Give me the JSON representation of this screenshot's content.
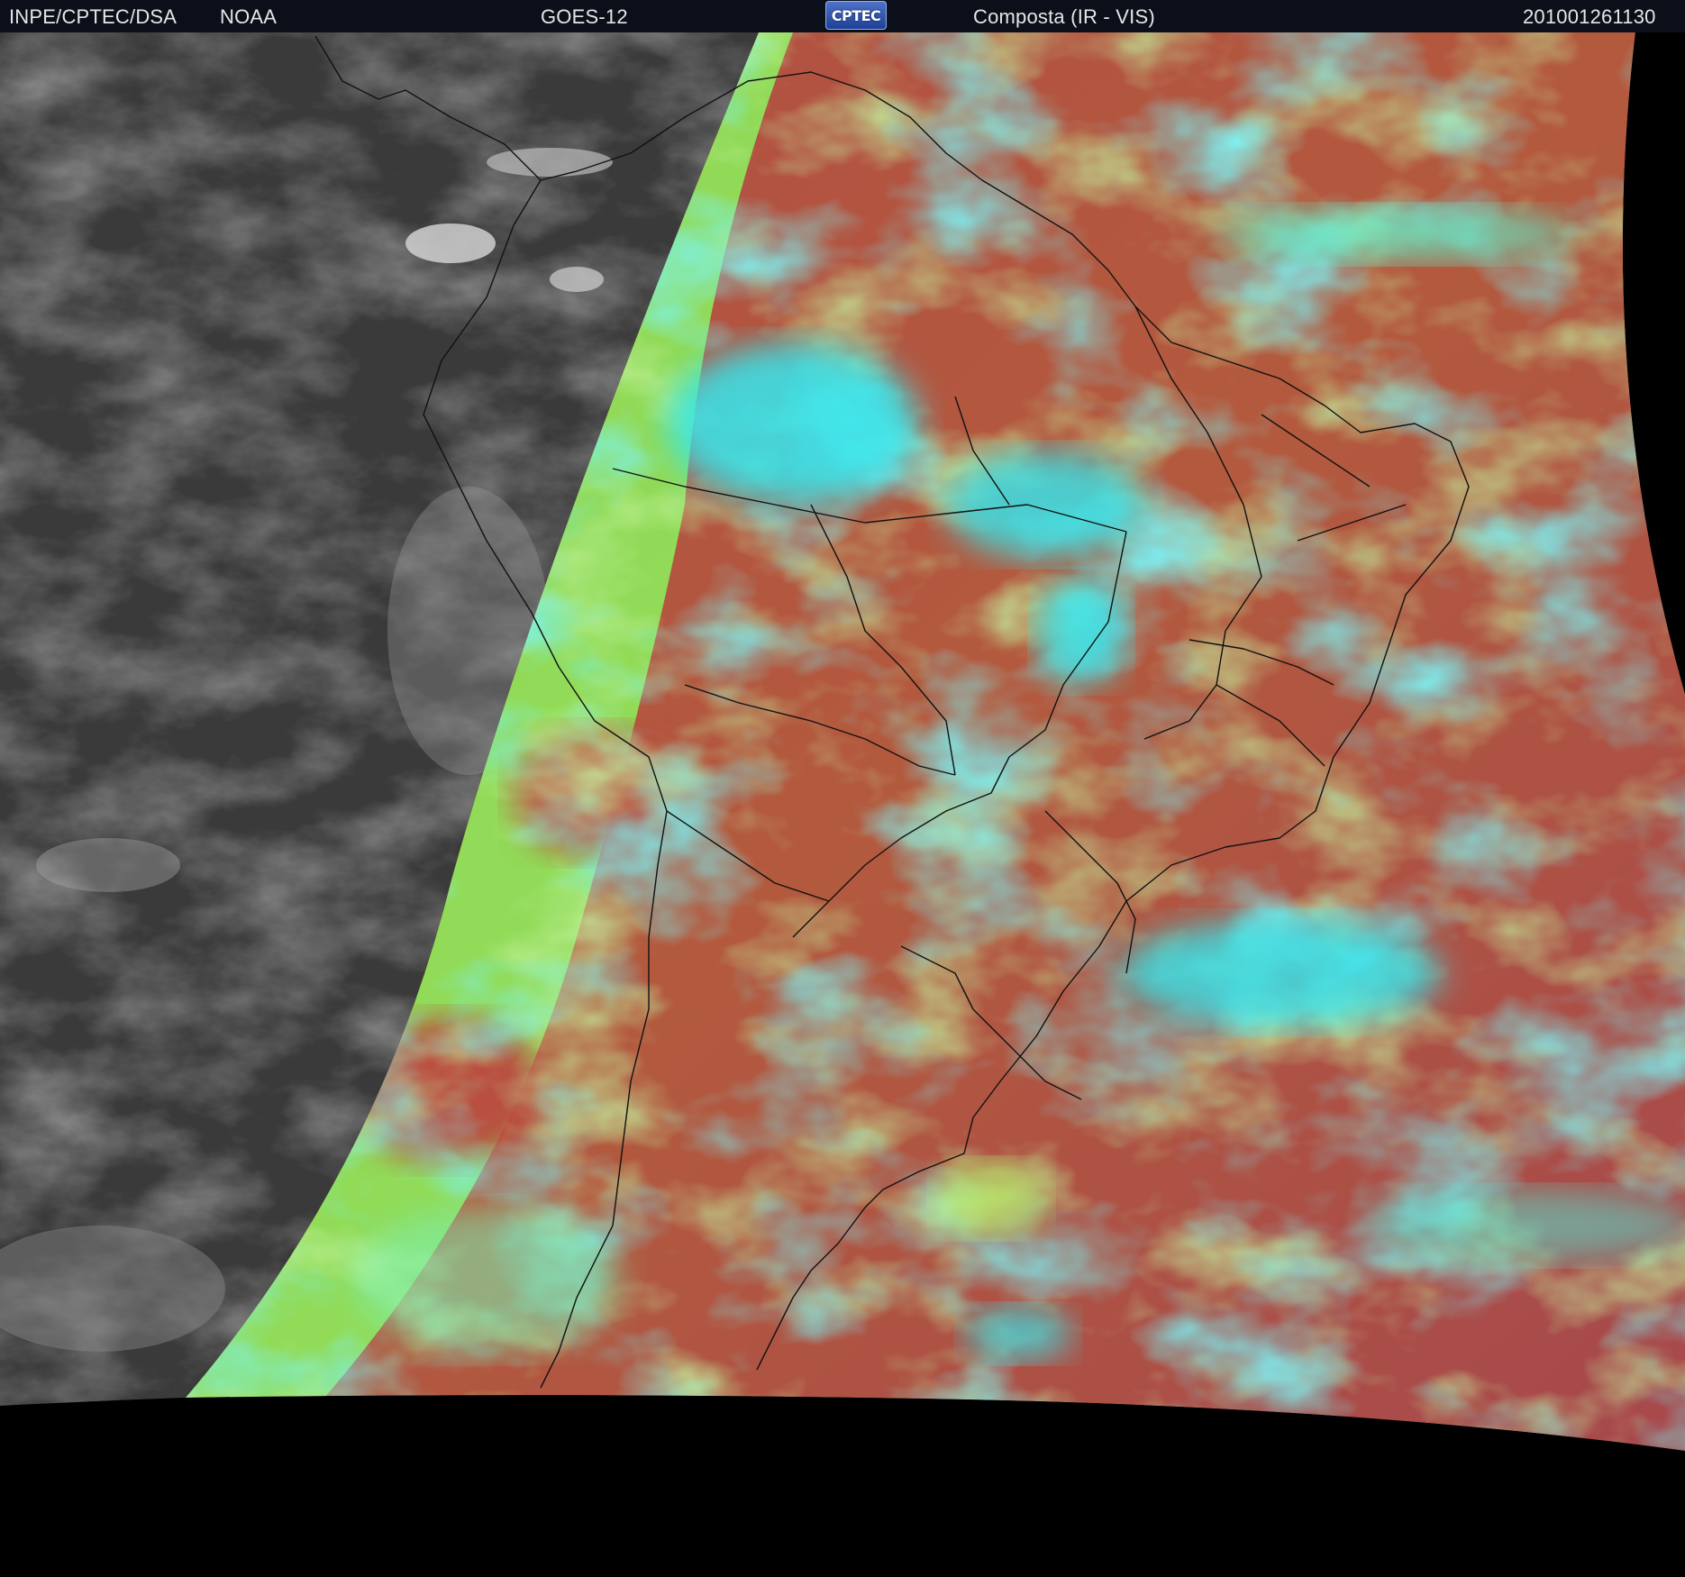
{
  "header": {
    "agency": "INPE/CPTEC/DSA",
    "source": "NOAA",
    "satellite": "GOES-12",
    "logo_text": "CPTEC",
    "product": "Composta (IR - VIS)",
    "timestamp": "201001261130"
  },
  "colors": {
    "header_background": "#0b0f1a",
    "night_side_gray": "#3a3a3a",
    "composite_land_ocean_red": "#b04a43",
    "composite_high_cloud_cyan": "#2fe6ee",
    "composite_low_cloud_green": "#8ee85a",
    "coastline_border": "#111111",
    "space_black": "#000000"
  }
}
